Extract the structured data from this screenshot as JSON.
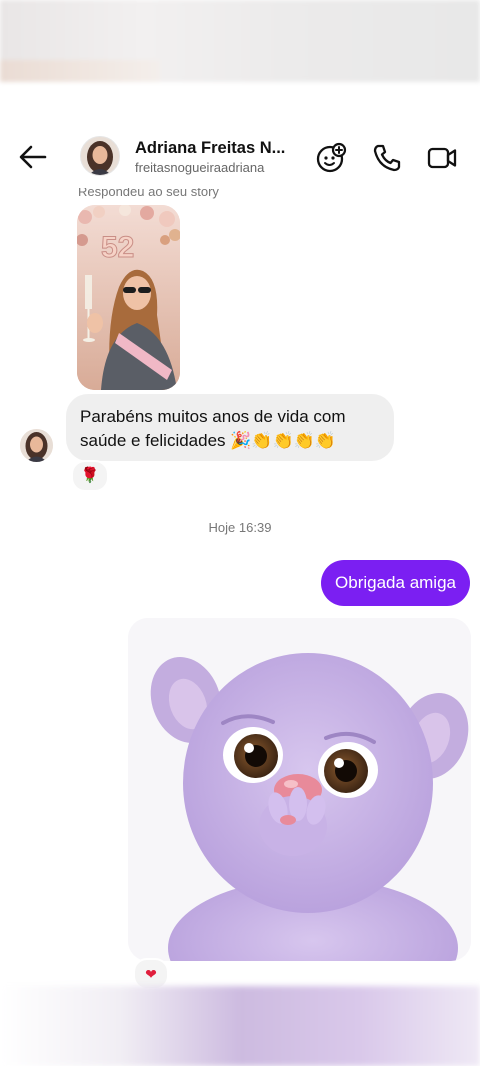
{
  "header": {
    "name": "Adriana Freitas N...",
    "handle": "freitasnogueiraadriana"
  },
  "story": {
    "caption": "Respondeu ao seu story",
    "balloon_number": "52"
  },
  "messages": {
    "incoming_line1": "Parabéns muitos anos de vida com",
    "incoming_line2": "saúde e felicidades 🎉👏👏👏👏",
    "incoming_reaction": "🌹",
    "timestamp": "Hoje 16:39",
    "outgoing_text": "Obrigada amiga",
    "sticker_reaction": "❤"
  },
  "colors": {
    "accent": "#7b1ff2",
    "incoming_bubble": "#efefef"
  },
  "icons": [
    "back-arrow-icon",
    "sticker-face-icon",
    "phone-icon",
    "video-camera-icon"
  ]
}
